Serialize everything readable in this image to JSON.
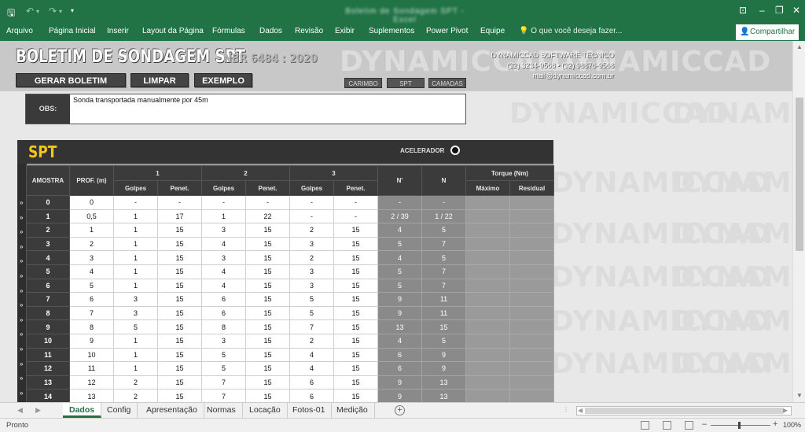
{
  "window": {
    "title": "Boletim de Sondagem SPT - Excel",
    "icons": {
      "save": "save-icon",
      "undo": "undo-icon",
      "redo": "redo-icon",
      "customize": "quick-access-icon"
    }
  },
  "ribbon": {
    "tabs": [
      "Arquivo",
      "Página Inicial",
      "Inserir",
      "Layout da Página",
      "Fórmulas",
      "Dados",
      "Revisão",
      "Exibir",
      "Suplementos",
      "Power Pivot",
      "Equipe"
    ],
    "tell_me": "O que você deseja fazer...",
    "share": "Compartilhar"
  },
  "app": {
    "title": "BOLETIM DE SONDAGEM SPT",
    "norm": "NBR 6484 : 2020",
    "watermark": "DYNAMICCAD",
    "buttons": {
      "generate": "GERAR BOLETIM",
      "clear": "LIMPAR",
      "example": "EXEMPLO"
    },
    "small_buttons": {
      "stamp": "CARIMBO",
      "spt": "SPT",
      "layers": "CAMADAS"
    },
    "company": {
      "name": "DYNAMICCAD SOFTWARE TÉCNICO",
      "phones": "(32) 3234-9568 • (32) 98876-9568",
      "email": "mail@dynamiccad.com.br"
    }
  },
  "obs": {
    "label": "OBS:",
    "text": "Sonda transportada manualmente por 45m"
  },
  "spt": {
    "title": "SPT",
    "accelerator_label": "ACELERADOR",
    "headers": {
      "sample": "AMOSTRA",
      "depth": "PROF. (m)",
      "group1": "1",
      "group2": "2",
      "group3": "3",
      "blows": "Golpes",
      "penet": "Penet.",
      "n_prime": "N'",
      "n": "N",
      "torque": "Torque (Nm)",
      "max": "Máximo",
      "residual": "Residual"
    },
    "rows": [
      [
        "0",
        "0",
        "-",
        "-",
        "-",
        "-",
        "-",
        "-",
        "-",
        "-"
      ],
      [
        "1",
        "0,5",
        "1",
        "17",
        "1",
        "22",
        "-",
        "-",
        "2 / 39",
        "1 / 22"
      ],
      [
        "2",
        "1",
        "1",
        "15",
        "3",
        "15",
        "2",
        "15",
        "4",
        "5"
      ],
      [
        "3",
        "2",
        "1",
        "15",
        "4",
        "15",
        "3",
        "15",
        "5",
        "7"
      ],
      [
        "4",
        "3",
        "1",
        "15",
        "3",
        "15",
        "2",
        "15",
        "4",
        "5"
      ],
      [
        "5",
        "4",
        "1",
        "15",
        "4",
        "15",
        "3",
        "15",
        "5",
        "7"
      ],
      [
        "6",
        "5",
        "1",
        "15",
        "4",
        "15",
        "3",
        "15",
        "5",
        "7"
      ],
      [
        "7",
        "6",
        "3",
        "15",
        "6",
        "15",
        "5",
        "15",
        "9",
        "11"
      ],
      [
        "8",
        "7",
        "3",
        "15",
        "6",
        "15",
        "5",
        "15",
        "9",
        "11"
      ],
      [
        "9",
        "8",
        "5",
        "15",
        "8",
        "15",
        "7",
        "15",
        "13",
        "15"
      ],
      [
        "10",
        "9",
        "1",
        "15",
        "3",
        "15",
        "2",
        "15",
        "4",
        "5"
      ],
      [
        "11",
        "10",
        "1",
        "15",
        "5",
        "15",
        "4",
        "15",
        "6",
        "9"
      ],
      [
        "12",
        "11",
        "1",
        "15",
        "5",
        "15",
        "4",
        "15",
        "6",
        "9"
      ],
      [
        "13",
        "12",
        "2",
        "15",
        "7",
        "15",
        "6",
        "15",
        "9",
        "13"
      ],
      [
        "14",
        "13",
        "2",
        "15",
        "7",
        "15",
        "6",
        "15",
        "9",
        "13"
      ]
    ]
  },
  "sheets": {
    "tabs": [
      "Dados",
      "Config",
      "Apresentação",
      "Normas",
      "Locação",
      "Fotos-01",
      "Medição"
    ],
    "active": "Dados"
  },
  "status": {
    "text": "Pronto",
    "zoom": "100%"
  }
}
